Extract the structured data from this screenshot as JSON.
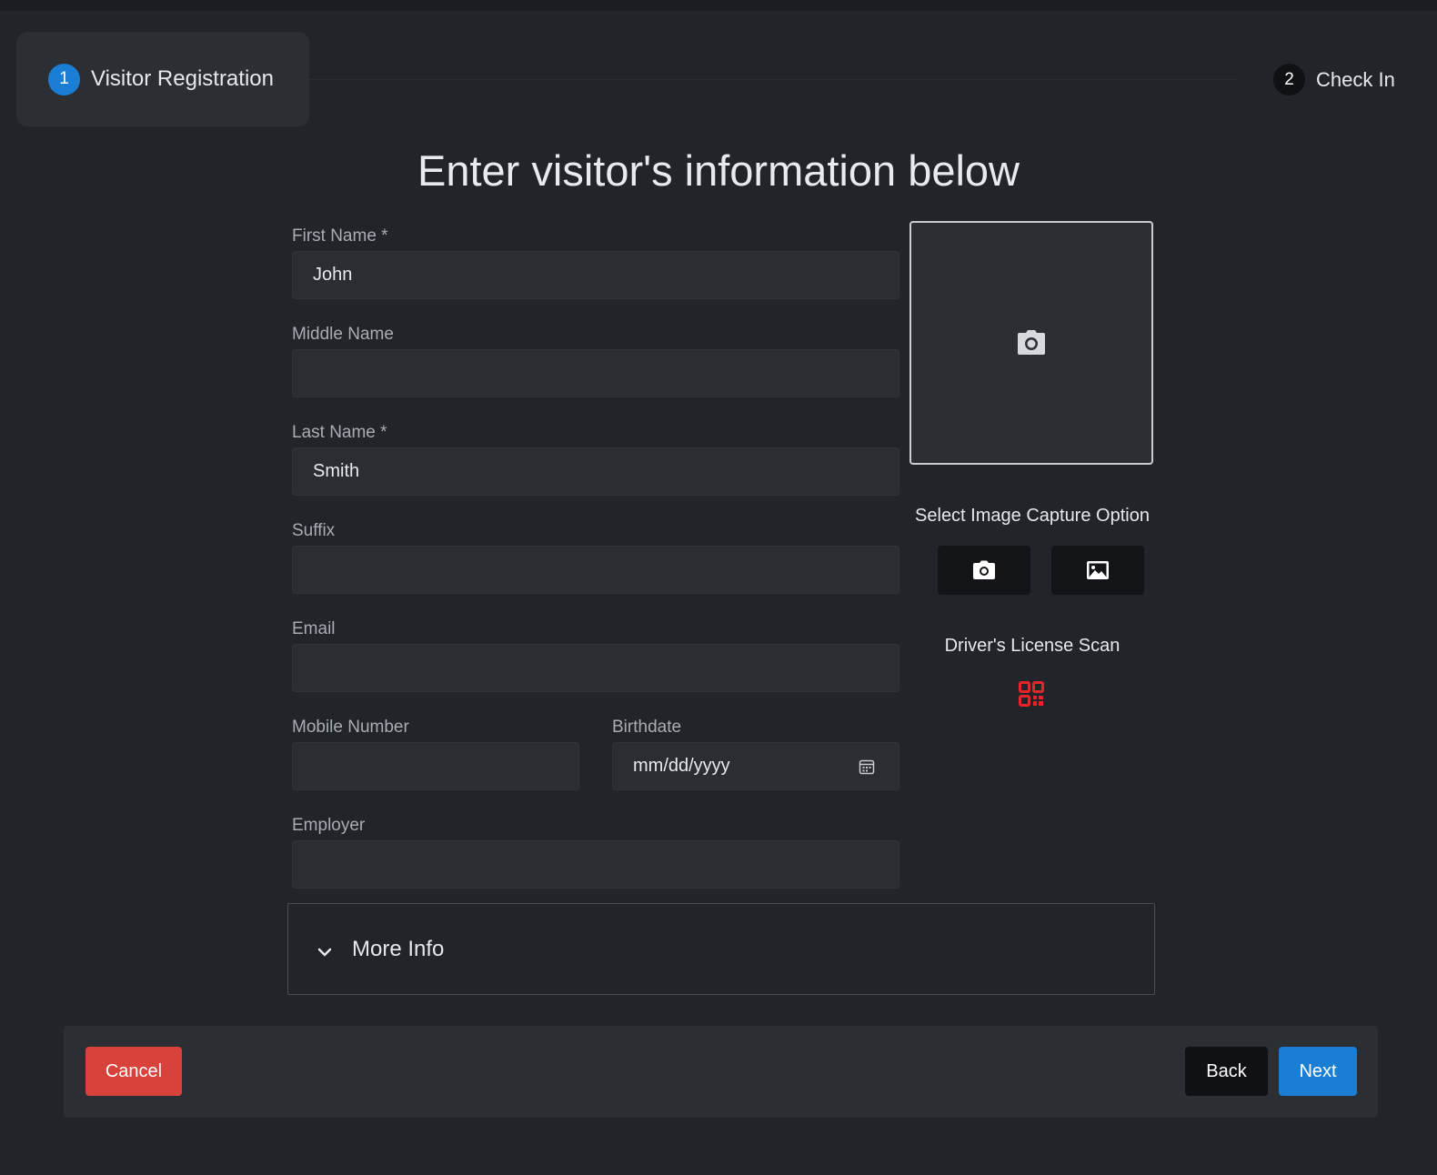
{
  "stepper": {
    "steps": [
      {
        "number": "1",
        "label": "Visitor Registration",
        "active": true
      },
      {
        "number": "2",
        "label": "Check In",
        "active": false
      }
    ]
  },
  "title": "Enter visitor's information below",
  "form": {
    "first_name": {
      "label": "First Name *",
      "value": "John"
    },
    "middle_name": {
      "label": "Middle Name",
      "value": ""
    },
    "last_name": {
      "label": "Last Name *",
      "value": "Smith"
    },
    "suffix": {
      "label": "Suffix",
      "value": ""
    },
    "email": {
      "label": "Email",
      "value": ""
    },
    "mobile": {
      "label": "Mobile Number",
      "value": ""
    },
    "birthdate": {
      "label": "Birthdate",
      "value": "mm/dd/yyyy"
    },
    "employer": {
      "label": "Employer",
      "value": ""
    }
  },
  "photo": {
    "capture_title": "Select Image Capture Option",
    "license_title": "Driver's License Scan"
  },
  "more_info": {
    "label": "More Info"
  },
  "footer": {
    "cancel": "Cancel",
    "back": "Back",
    "next": "Next"
  },
  "colors": {
    "accent": "#1a7fd4",
    "danger": "#d9413b",
    "qr": "#e3262b"
  },
  "icons": [
    "camera-icon",
    "image-icon",
    "qr-scan-icon",
    "calendar-icon",
    "chevron-down-icon"
  ]
}
